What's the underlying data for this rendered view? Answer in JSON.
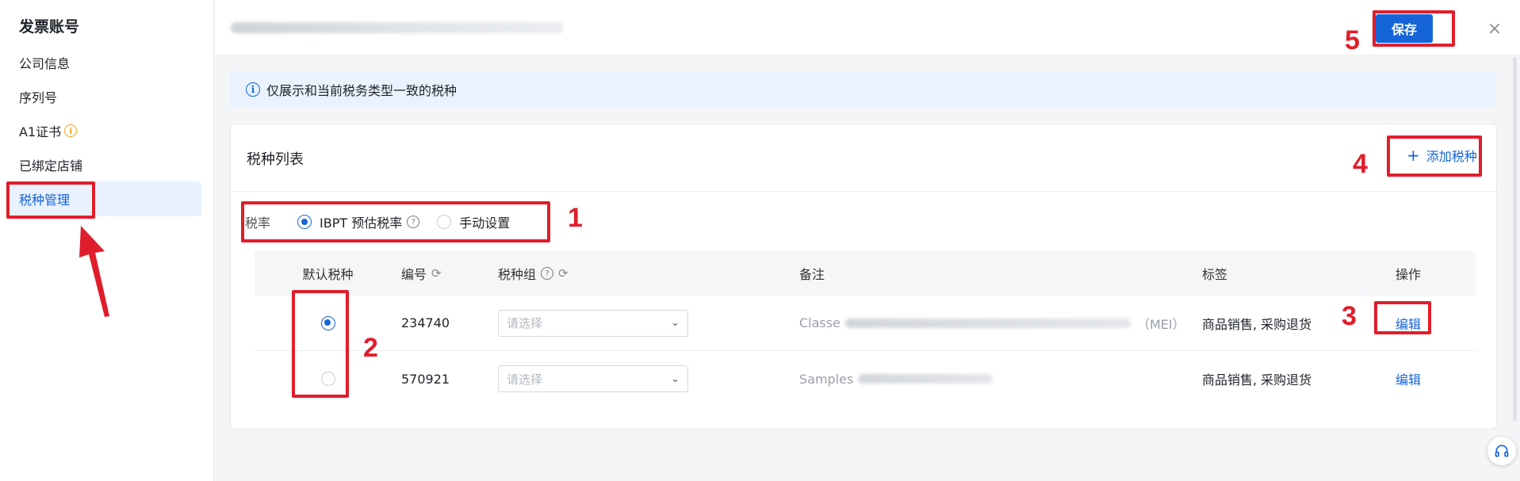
{
  "sidebar": {
    "title": "发票账号",
    "items": [
      {
        "label": "公司信息"
      },
      {
        "label": "序列号"
      },
      {
        "label": "A1证书"
      },
      {
        "label": "已绑定店铺"
      },
      {
        "label": "税种管理"
      }
    ]
  },
  "header": {
    "save_label": "保存",
    "close_glyph": "×"
  },
  "notice": {
    "icon_glyph": "i",
    "text": "仅展示和当前税务类型一致的税种"
  },
  "card": {
    "title": "税种列表",
    "add_label": "添加税种",
    "add_glyph": "+",
    "rate": {
      "label": "税率",
      "option_ibpt": "IBPT 预估税率",
      "option_manual": "手动设置",
      "selected": "IBPT 预估税率"
    },
    "columns": {
      "default": "默认税种",
      "code": "编号",
      "group": "税种组",
      "note": "备注",
      "tags": "标签",
      "action": "操作"
    },
    "rows": [
      {
        "code": "234740",
        "group_placeholder": "请选择",
        "note_prefix": "Classe",
        "note_suffix": "（MEI）",
        "tags": "商品销售, 采购退货",
        "action": "编辑",
        "is_default": true
      },
      {
        "code": "570921",
        "group_placeholder": "请选择",
        "note_prefix": "Samples",
        "note_suffix": "",
        "tags": "商品销售, 采购退货",
        "action": "编辑",
        "is_default": false
      }
    ]
  },
  "annotations": {
    "n1": "1",
    "n2": "2",
    "n3": "3",
    "n4": "4",
    "n5": "5",
    "color": "#e01e2b"
  },
  "colors": {
    "accent": "#1565d8",
    "active_bg": "#e8f1fd",
    "notice_bg": "#e9f2fd",
    "warning": "#f3a21b"
  },
  "icons": {
    "info": "info-icon",
    "question": "question-icon",
    "refresh": "refresh-icon",
    "chevron": "chevron-down-icon",
    "close": "close-icon",
    "plus": "plus-icon",
    "support": "headset-icon"
  }
}
